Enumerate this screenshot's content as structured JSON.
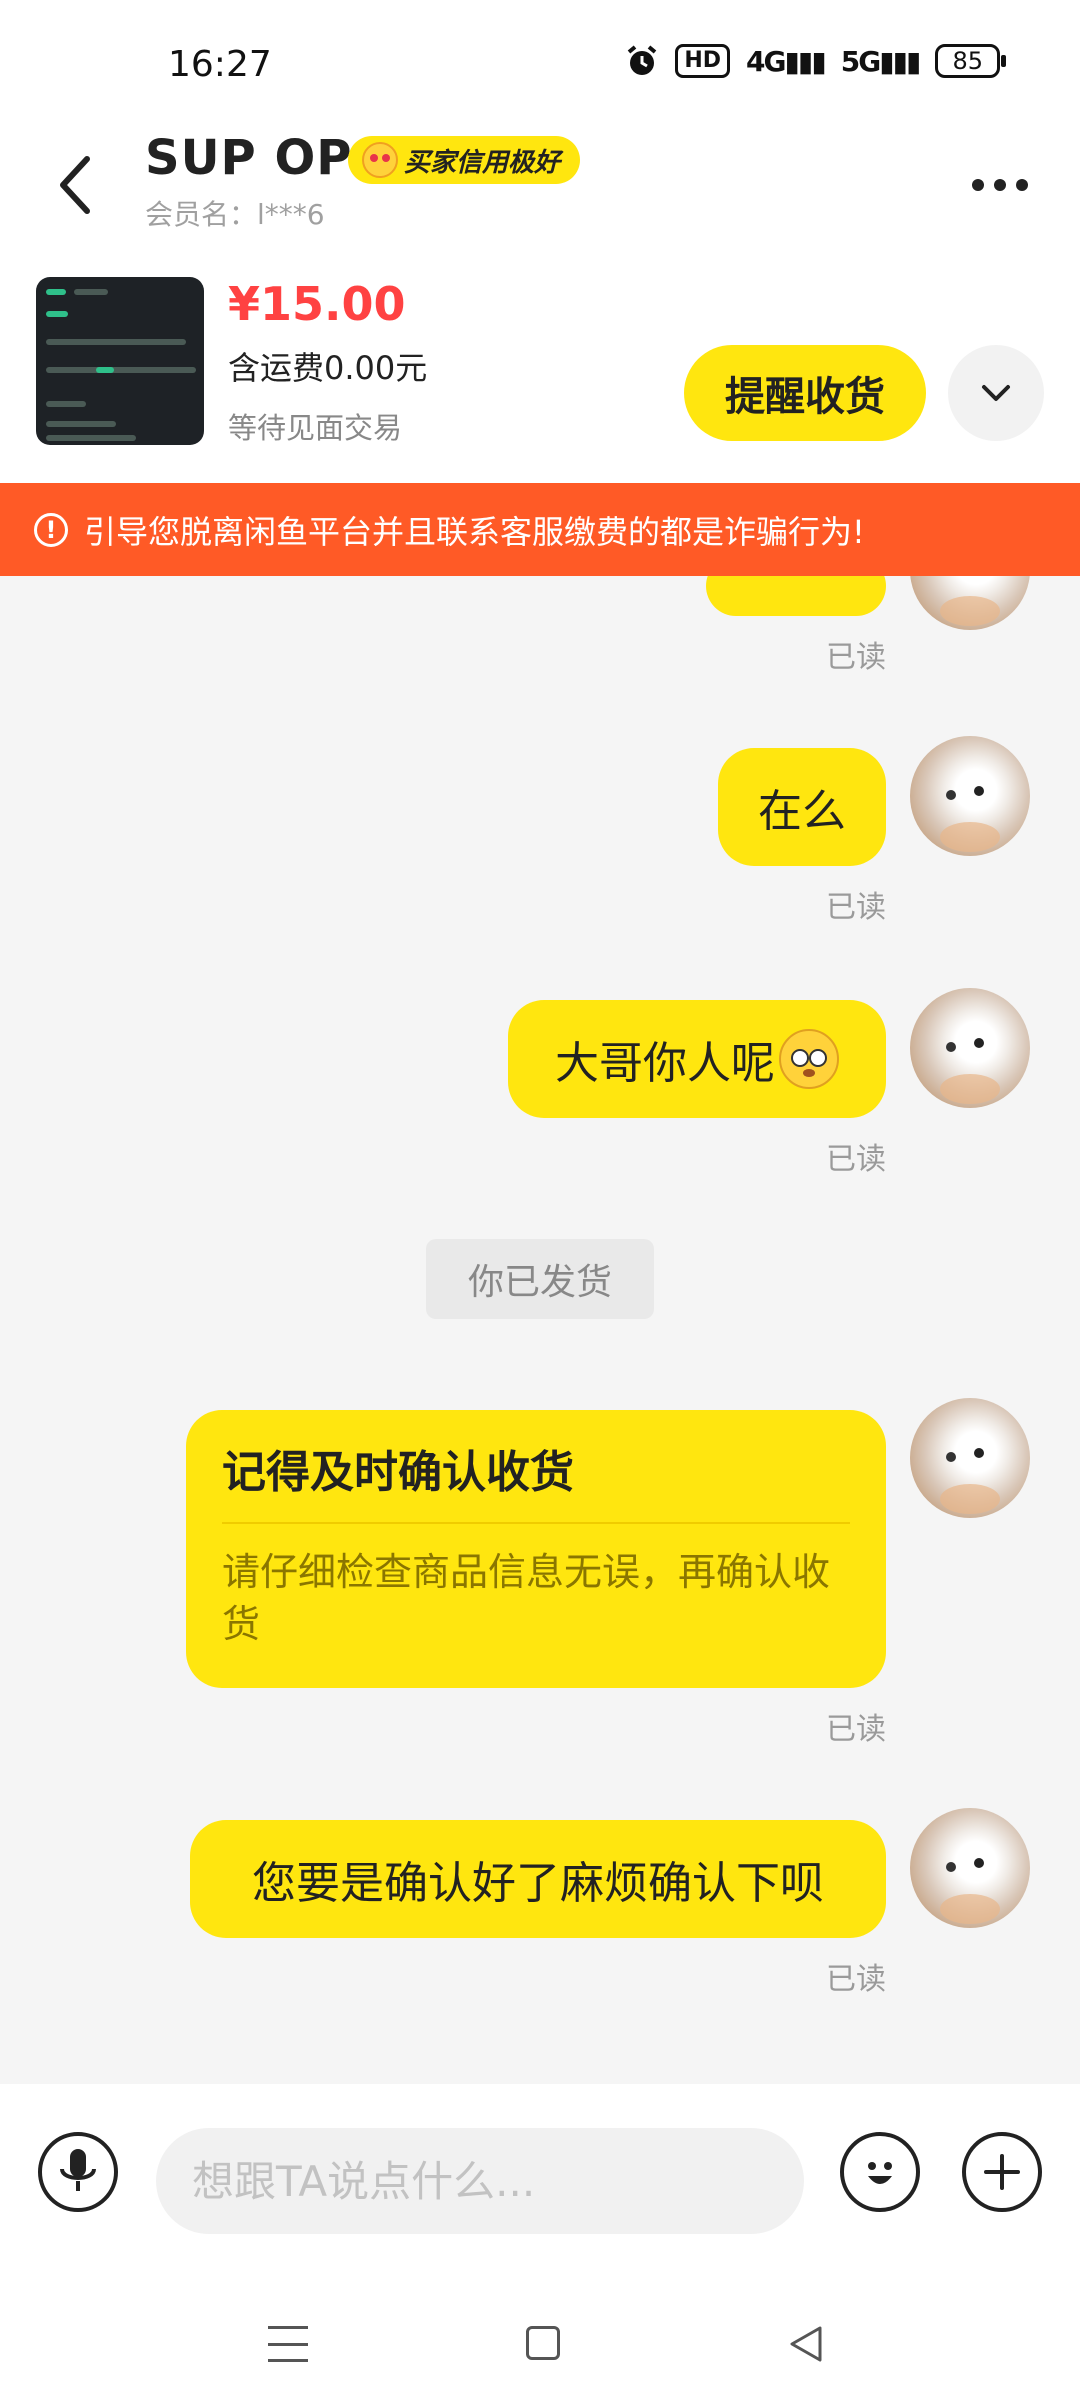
{
  "status_bar": {
    "time": "16:27",
    "hd_label": "HD",
    "net1": "4G",
    "net2": "5G",
    "battery": "85"
  },
  "header": {
    "seller_name": "SUP  OP",
    "credit_badge": "买家信用极好",
    "member_label": "会员名：l***6"
  },
  "product": {
    "price": "¥15.00",
    "shipping": "含运费0.00元",
    "status": "等待见面交易",
    "remind_button": "提醒收货"
  },
  "warning": {
    "text": "引导您脱离闲鱼平台并且联系客服缴费的都是诈骗行为!"
  },
  "chat": {
    "read_label": "已读",
    "messages": [
      {
        "text": "在么"
      },
      {
        "text": "大哥你人呢"
      },
      {
        "text": "您要是确认好了麻烦确认下呗"
      }
    ],
    "system_tag": "你已发货",
    "card": {
      "title": "记得及时确认收货",
      "desc": "请仔细检查商品信息无误，再确认收货"
    }
  },
  "input": {
    "placeholder": "想跟TA说点什么..."
  },
  "colors": {
    "accent": "#ffe60f",
    "price": "#ff4242",
    "warning_bg": "#ff5a26"
  },
  "icons": [
    "back-arrow-icon",
    "more-icon",
    "chevron-down-icon",
    "warning-icon",
    "mic-icon",
    "emoji-icon",
    "plus-icon",
    "menu-icon",
    "home-icon",
    "back-triangle-icon"
  ]
}
